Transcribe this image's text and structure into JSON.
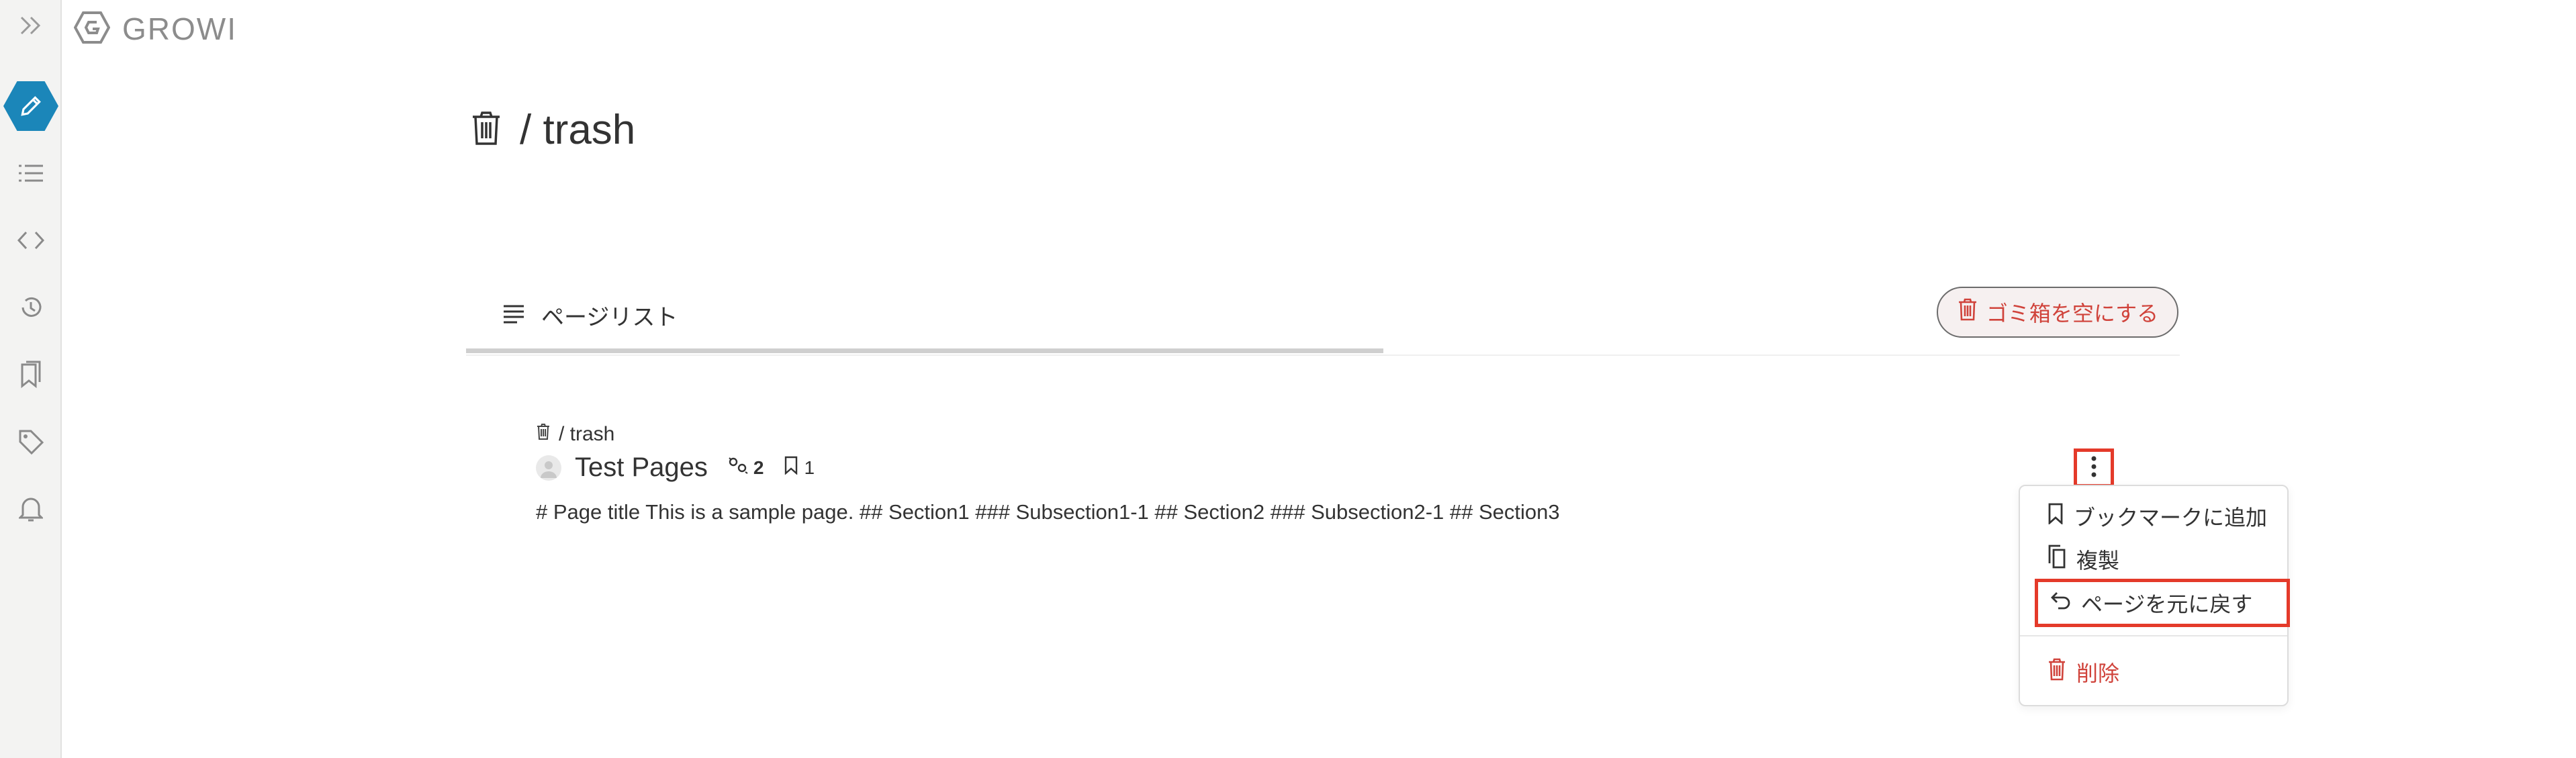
{
  "app": {
    "brand_name": "GROWI",
    "accent_color": "#1b86b9",
    "danger_color": "#d0433b"
  },
  "sidebar": {
    "items": [
      {
        "name": "edit",
        "icon": "pencil-icon"
      },
      {
        "name": "page-tree",
        "icon": "list-icon"
      },
      {
        "name": "custom-sidebar",
        "icon": "code-icon"
      },
      {
        "name": "recent-changes",
        "icon": "history-icon"
      },
      {
        "name": "bookmarks",
        "icon": "bookmark-icon"
      },
      {
        "name": "tags",
        "icon": "tag-icon"
      },
      {
        "name": "notifications",
        "icon": "bell-icon"
      }
    ]
  },
  "page": {
    "title": "/ trash"
  },
  "tabs": {
    "pagelist_label": "ページリスト",
    "empty_trash_label": "ゴミ箱を空にする"
  },
  "list": {
    "items": [
      {
        "path": "/ trash",
        "title": "Test Pages",
        "seen_count": "2",
        "bookmark_count": "1",
        "snippet": "# Page title This is a sample page. ## Section1 ### Subsection1-1 ## Section2 ### Subsection2-1 ## Section3"
      }
    ]
  },
  "menu": {
    "bookmark": "ブックマークに追加",
    "duplicate": "複製",
    "revert": "ページを元に戻す",
    "delete": "削除"
  }
}
